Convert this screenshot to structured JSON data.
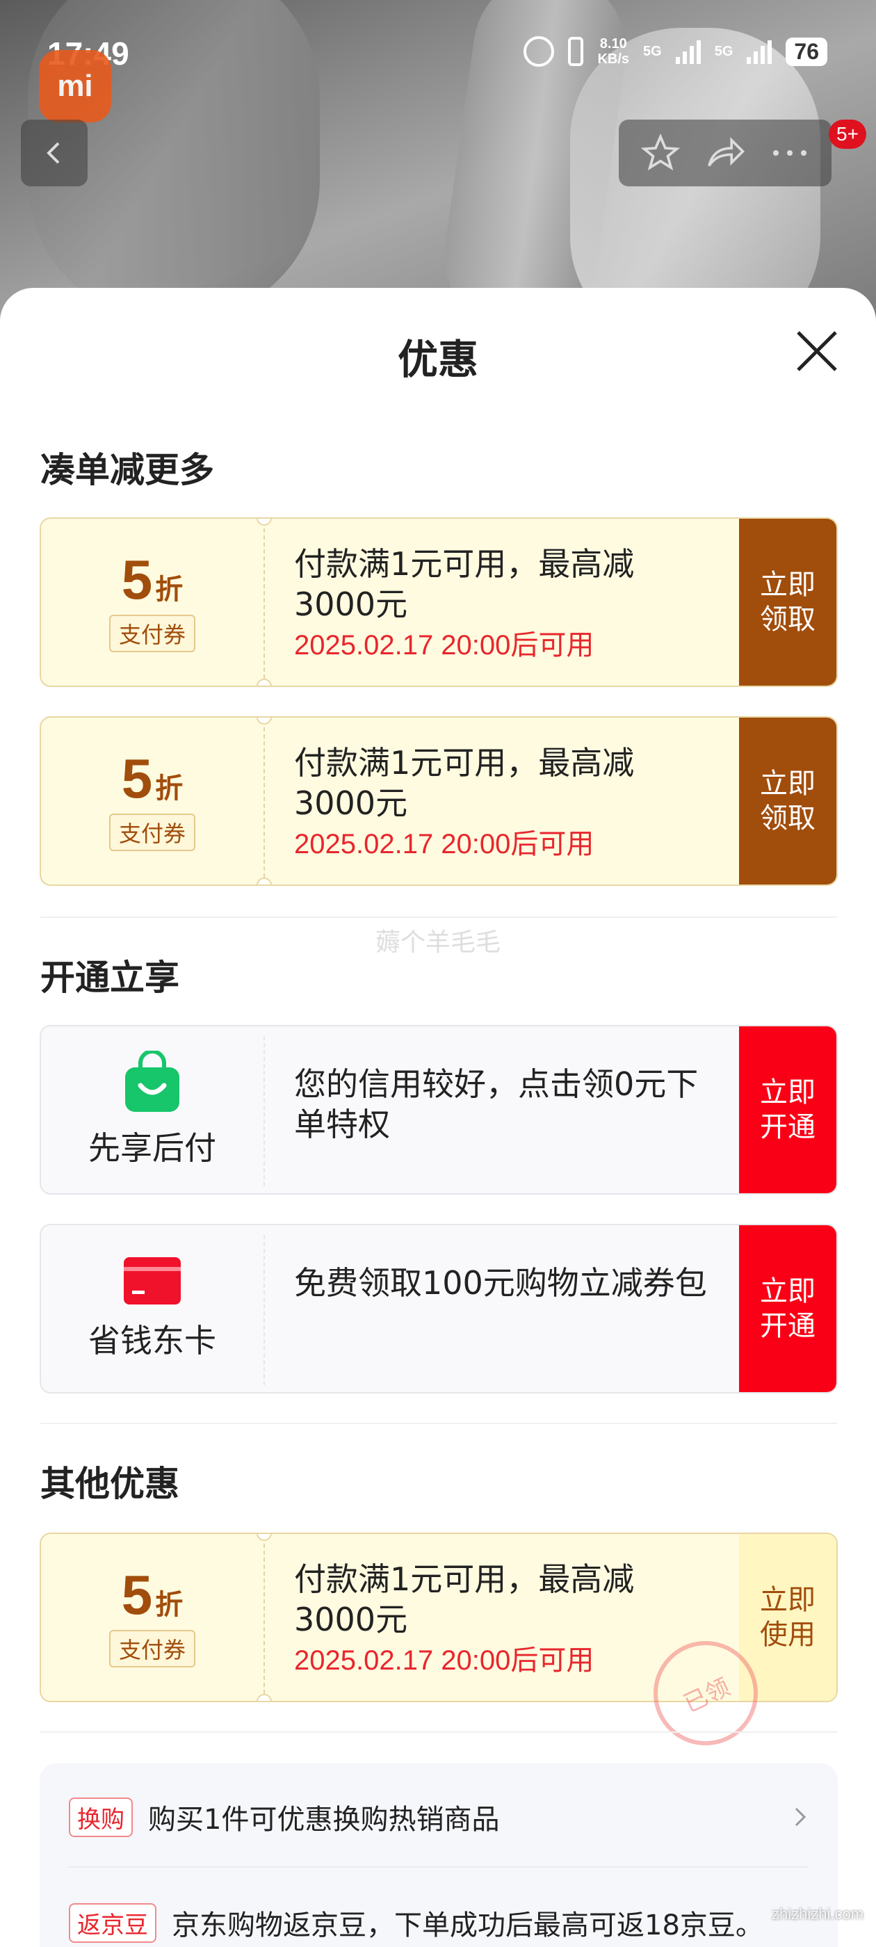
{
  "status_bar": {
    "time": "17:49",
    "net_speed_value": "8.10",
    "net_speed_unit": "KB/s",
    "signal1": "5G",
    "signal2": "5G",
    "battery": "76"
  },
  "app_logo": "mi",
  "nav": {
    "badge": "5+"
  },
  "sheet": {
    "title": "优惠",
    "sections": {
      "combine": "凑单减更多",
      "activate": "开通立享",
      "other": "其他优惠"
    }
  },
  "coupons": [
    {
      "discount": "5",
      "unit": "折",
      "tag": "支付券",
      "desc": "付款满1元可用，最高减3000元",
      "time": "2025.02.17 20:00后可用",
      "action": "立即领取"
    },
    {
      "discount": "5",
      "unit": "折",
      "tag": "支付券",
      "desc": "付款满1元可用，最高减3000元",
      "time": "2025.02.17 20:00后可用",
      "action": "立即领取"
    }
  ],
  "watermark_mid": "薅个羊毛毛",
  "services": [
    {
      "name": "先享后付",
      "desc": "您的信用较好，点击领0元下单特权",
      "action": "立即开通",
      "icon": "shopping-bag-icon"
    },
    {
      "name": "省钱东卡",
      "desc": "免费领取100元购物立减券包",
      "action": "立即开通",
      "icon": "card-icon"
    }
  ],
  "other_coupon": {
    "discount": "5",
    "unit": "折",
    "tag": "支付券",
    "desc": "付款满1元可用，最高减3000元",
    "time": "2025.02.17 20:00后可用",
    "action": "立即使用",
    "stamp": "已领"
  },
  "benefits": [
    {
      "badge": "换购",
      "text": "购买1件可优惠换购热销商品"
    },
    {
      "badge": "返京豆",
      "text": "京东购物返京豆，下单成功后最高可返18京豆。"
    }
  ],
  "corner_watermark": "zhizhizhi.com",
  "colors": {
    "brown": "#a14d0c",
    "red": "#fa0016",
    "gold_bg": "#fffbe0",
    "time_red": "#e8262d"
  }
}
